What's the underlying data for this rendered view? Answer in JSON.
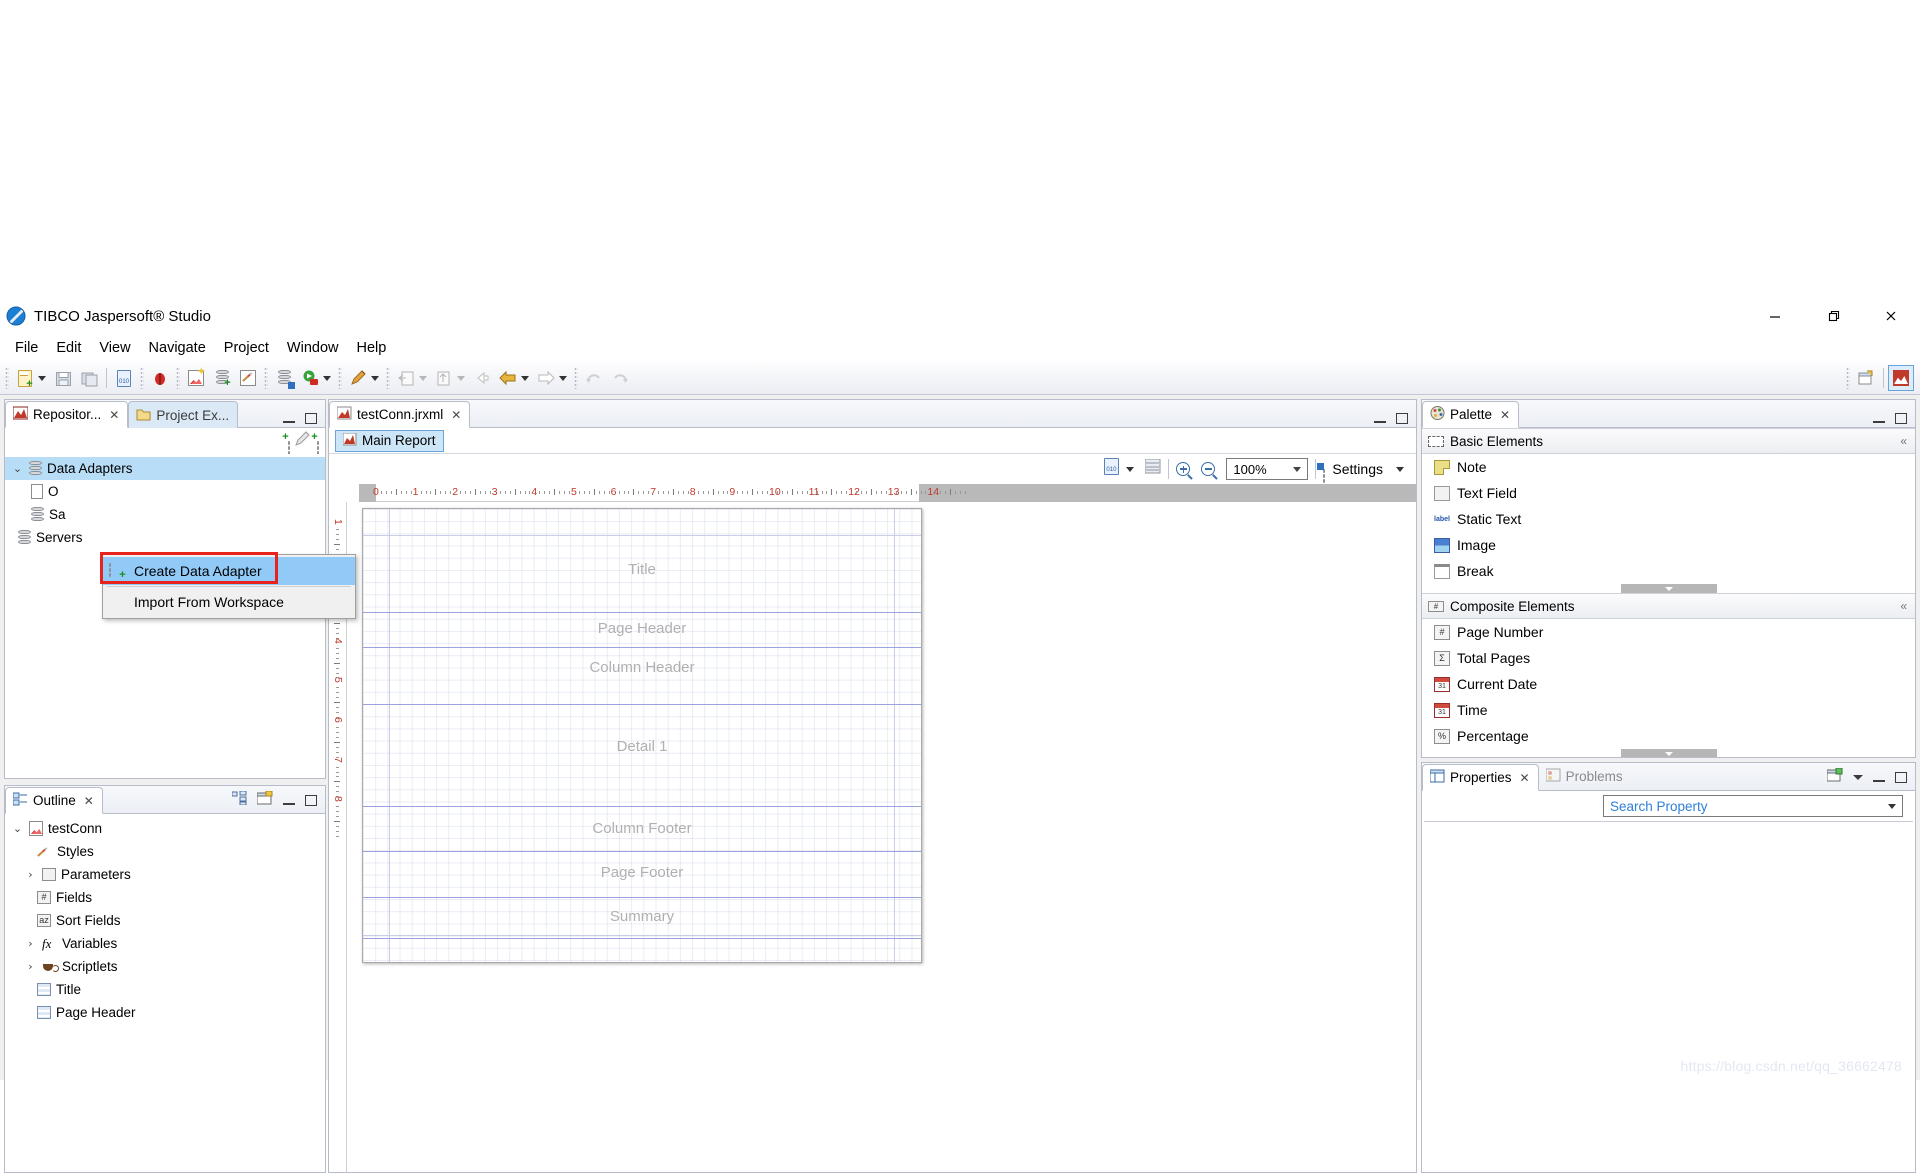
{
  "window": {
    "title": "TIBCO Jaspersoft® Studio",
    "app_icon": "jaspersoft-icon",
    "minimize": "–",
    "maximize": "❐",
    "close": "✕"
  },
  "menubar": {
    "items": [
      "File",
      "Edit",
      "View",
      "Navigate",
      "Project",
      "Window",
      "Help"
    ]
  },
  "toolbar": {
    "icons": [
      "new-document-icon",
      "save-icon",
      "save-all-icon",
      "compile-report-icon",
      "debug-icon",
      "new-report-icon",
      "new-datasource-icon",
      "new-style-icon",
      "preview-icon",
      "run-icon",
      "edit-icon",
      "export-icon",
      "import-icon",
      "back-icon",
      "previous-icon",
      "forward-icon",
      "undo-icon",
      "redo-icon"
    ],
    "right_icons": [
      "open-perspective-icon",
      "report-perspective-icon"
    ]
  },
  "left_top_view": {
    "tabs": [
      {
        "label": "Repositor...",
        "icon": "repository-icon",
        "active": true,
        "closable": true
      },
      {
        "label": "Project Ex...",
        "icon": "project-explorer-icon",
        "active": false,
        "closable": false
      }
    ],
    "controls": [
      "minimize-icon",
      "maximize-icon"
    ],
    "toolbar_icons": [
      "new-data-adapter-icon",
      "edit-icon",
      "server-icon"
    ],
    "tree": [
      {
        "label": "Data Adapters",
        "icon": "database-icon",
        "twisty": "v",
        "indent": 0,
        "selected": true
      },
      {
        "label": "O",
        "icon": "one-empty-record-icon",
        "twisty": "",
        "indent": 1,
        "selected": false
      },
      {
        "label": "Sa",
        "icon": "database-icon",
        "twisty": "",
        "indent": 1,
        "selected": false
      },
      {
        "label": "Servers",
        "icon": "server-icon",
        "twisty": "",
        "indent": 0,
        "selected": false
      }
    ]
  },
  "context_menu": {
    "items": [
      {
        "label": "Create Data Adapter",
        "icon": "new-data-adapter-icon",
        "highlighted": true
      },
      {
        "label": "Import From Workspace",
        "icon": "",
        "highlighted": false
      }
    ],
    "highlight_color": "#91c9f7",
    "annotation_color": "#e8231c"
  },
  "editor": {
    "tabs": [
      {
        "label": "testConn.jrxml",
        "icon": "jrxml-icon",
        "active": true,
        "closable": true
      }
    ],
    "controls": [
      "minimize-icon",
      "maximize-icon"
    ],
    "subtabs": [
      {
        "label": "Main Report",
        "icon": "report-icon",
        "active": true
      }
    ],
    "toolbar": {
      "dataset_icon": "dataset-icon",
      "dataset_caret": "chevron-down-icon",
      "list_icon": "band-list-icon",
      "zoom_in_icon": "zoom-in-icon",
      "zoom_out_icon": "zoom-out-icon",
      "zoom_value": "100%",
      "settings_icon": "settings-icon",
      "settings_label": "Settings",
      "settings_caret": "chevron-down-icon"
    },
    "ruler": {
      "h_ticks": [
        "0",
        "1",
        "2",
        "3",
        "4",
        "5",
        "6",
        "7",
        "8",
        "9",
        "10",
        "11",
        "12",
        "13",
        "14"
      ],
      "v_ticks": [
        "1",
        "2",
        "3",
        "4",
        "5",
        "6",
        "7",
        "8"
      ]
    },
    "bands": [
      {
        "name": "Title",
        "label": "Title"
      },
      {
        "name": "Page Header",
        "label": "Page Header"
      },
      {
        "name": "Column Header",
        "label": "Column Header"
      },
      {
        "name": "Detail 1",
        "label": "Detail 1"
      },
      {
        "name": "Column Footer",
        "label": "Column Footer"
      },
      {
        "name": "Page Footer",
        "label": "Page Footer"
      },
      {
        "name": "Summary",
        "label": "Summary"
      }
    ]
  },
  "palette": {
    "tabs": [
      {
        "label": "Palette",
        "icon": "palette-icon",
        "active": true,
        "closable": true
      }
    ],
    "controls": [
      "minimize-icon",
      "maximize-icon"
    ],
    "groups": [
      {
        "title": "Basic Elements",
        "icon": "basic-elements-icon",
        "pin": "«",
        "items": [
          {
            "label": "Note",
            "icon": "note-icon"
          },
          {
            "label": "Text Field",
            "icon": "text-field-icon"
          },
          {
            "label": "Static Text",
            "icon": "static-text-icon"
          },
          {
            "label": "Image",
            "icon": "image-icon"
          },
          {
            "label": "Break",
            "icon": "break-icon"
          }
        ]
      },
      {
        "title": "Composite Elements",
        "icon": "composite-elements-icon",
        "pin": "«",
        "items": [
          {
            "label": "Page Number",
            "icon": "page-number-icon"
          },
          {
            "label": "Total Pages",
            "icon": "total-pages-icon"
          },
          {
            "label": "Current Date",
            "icon": "current-date-icon"
          },
          {
            "label": "Time",
            "icon": "time-icon"
          },
          {
            "label": "Percentage",
            "icon": "percentage-icon"
          }
        ]
      }
    ]
  },
  "properties": {
    "tabs": [
      {
        "label": "Properties",
        "icon": "properties-icon",
        "active": true,
        "closable": true
      },
      {
        "label": "Problems",
        "icon": "problems-icon",
        "active": false,
        "closable": false
      }
    ],
    "controls": [
      "new-view-icon",
      "view-menu-icon",
      "minimize-icon",
      "maximize-icon"
    ],
    "search_placeholder": "Search Property",
    "search_value": "Search Property"
  },
  "outline": {
    "tabs": [
      {
        "label": "Outline",
        "icon": "outline-icon",
        "active": true,
        "closable": true
      }
    ],
    "toolbar_icons": [
      "hierarchy-icon",
      "properties-view-icon"
    ],
    "controls": [
      "minimize-icon",
      "maximize-icon"
    ],
    "tree": [
      {
        "label": "testConn",
        "icon": "report-icon",
        "twisty": "v",
        "indent": 0
      },
      {
        "label": "Styles",
        "icon": "styles-icon",
        "twisty": "",
        "indent": 1
      },
      {
        "label": "Parameters",
        "icon": "parameters-icon",
        "twisty": ">",
        "indent": 1
      },
      {
        "label": "Fields",
        "icon": "fields-icon",
        "twisty": "",
        "indent": 1
      },
      {
        "label": "Sort Fields",
        "icon": "sort-fields-icon",
        "twisty": "",
        "indent": 1
      },
      {
        "label": "Variables",
        "icon": "variables-icon",
        "twisty": ">",
        "indent": 1
      },
      {
        "label": "Scriptlets",
        "icon": "scriptlets-icon",
        "twisty": ">",
        "indent": 1
      },
      {
        "label": "Title",
        "icon": "band-icon",
        "twisty": "",
        "indent": 1
      },
      {
        "label": "Page Header",
        "icon": "band-icon",
        "twisty": "",
        "indent": 1
      }
    ]
  },
  "watermark": {
    "text": "https://blog.csdn.net/qq_36662478"
  }
}
